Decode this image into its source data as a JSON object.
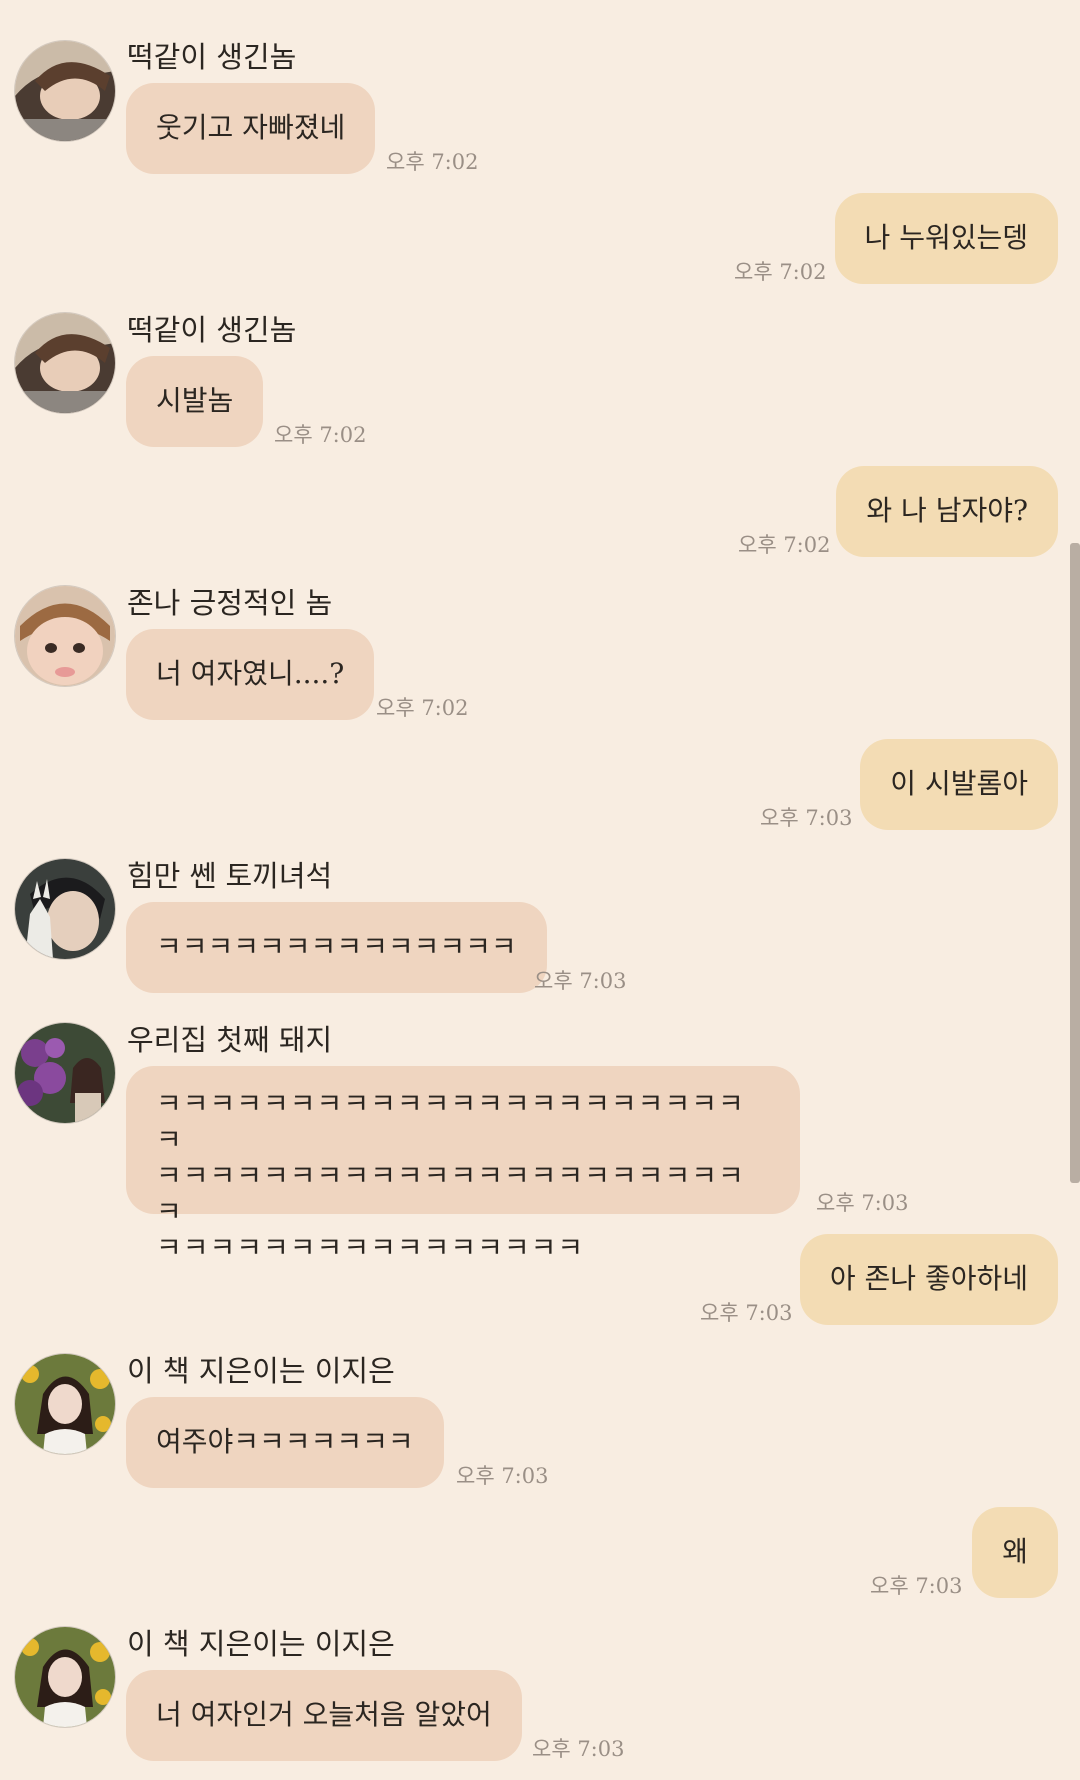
{
  "messages": [
    {
      "side": "left",
      "sender": "떡같이 생긴놈",
      "avatar": "avatar-boy-lying",
      "text": "웃기고 자빠졌네",
      "time": "오후 7:02"
    },
    {
      "side": "right",
      "text": "나 누워있는뎅",
      "time": "오후 7:02"
    },
    {
      "side": "left",
      "sender": "떡같이 생긴놈",
      "avatar": "avatar-boy-lying",
      "text": "시발놈",
      "time": "오후 7:02"
    },
    {
      "side": "right",
      "text": "와 나 남자야?",
      "time": "오후 7:02"
    },
    {
      "side": "left",
      "sender": "존나 긍정적인 놈",
      "avatar": "avatar-boy-closeup",
      "text": "너 여자였니....?",
      "time": "오후 7:02"
    },
    {
      "side": "right",
      "text": "이 시발롬아",
      "time": "오후 7:03"
    },
    {
      "side": "left",
      "sender": "힘만 쎈 토끼녀석",
      "avatar": "avatar-boy-peace",
      "text": "ㅋㅋㅋㅋㅋㅋㅋㅋㅋㅋㅋㅋㅋㅋ",
      "time": "오후 7:03"
    },
    {
      "side": "left",
      "sender": "우리집 첫째 돼지",
      "avatar": "avatar-girl-flowers",
      "lines": [
        "ㅋㅋㅋㅋㅋㅋㅋㅋㅋㅋㅋㅋㅋㅋㅋㅋㅋㅋㅋㅋㅋㅋㅋ",
        "ㅋㅋㅋㅋㅋㅋㅋㅋㅋㅋㅋㅋㅋㅋㅋㅋㅋㅋㅋㅋㅋㅋㅋ",
        "ㅋㅋㅋㅋㅋㅋㅋㅋㅋㅋㅋㅋㅋㅋㅋㅋ"
      ],
      "time": "오후 7:03"
    },
    {
      "side": "right",
      "text": "아 존나 좋아하네",
      "time": "오후 7:03"
    },
    {
      "side": "left",
      "sender": "이 책 지은이는 이지은",
      "avatar": "avatar-girl-sunflower",
      "text": "여주야ㅋㅋㅋㅋㅋㅋㅋ",
      "time": "오후 7:03"
    },
    {
      "side": "right",
      "text": "왜",
      "time": "오후 7:03"
    },
    {
      "side": "left",
      "sender": "이 책 지은이는 이지은",
      "avatar": "avatar-girl-sunflower",
      "text": "너 여자인거 오늘처음 알았어",
      "time": "오후 7:03"
    }
  ],
  "colors": {
    "background": "#f8ede1",
    "bubble_left": "#efd5c0",
    "bubble_right": "#f3dcb4",
    "time": "#9a8f86"
  }
}
